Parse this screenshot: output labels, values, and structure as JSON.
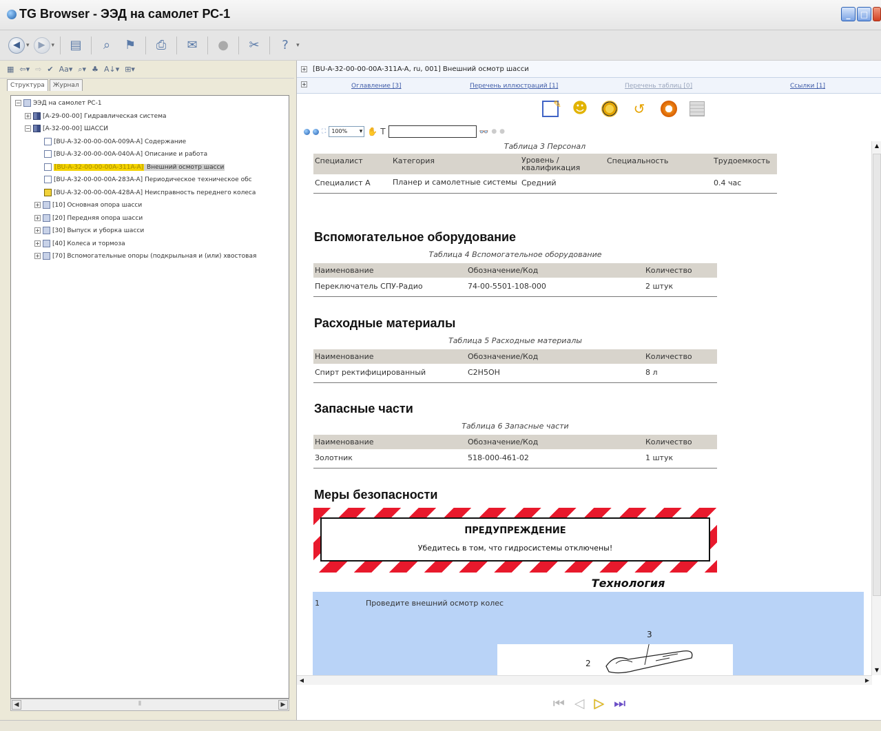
{
  "window": {
    "title": "TG Browser - ЭЭД на самолет РС-1"
  },
  "left": {
    "tabs": [
      "Структура",
      "Журнал"
    ],
    "tree": [
      {
        "indent": 0,
        "exp": "−",
        "icon": "folder",
        "label": "ЭЭД на самолет РС-1"
      },
      {
        "indent": 1,
        "exp": "+",
        "icon": "book",
        "label": "[A-29-00-00] Гидравлическая система"
      },
      {
        "indent": 1,
        "exp": "−",
        "icon": "book",
        "label": "[A-32-00-00] ШАССИ"
      },
      {
        "indent": 3,
        "exp": "",
        "icon": "doc",
        "label": "[BU-A-32-00-00-00A-009A-A] Содержание"
      },
      {
        "indent": 3,
        "exp": "",
        "icon": "doc",
        "label": "[BU-A-32-00-00-00A-040A-A] Описание и работа"
      },
      {
        "indent": 3,
        "exp": "",
        "icon": "doc",
        "label": "[BU-A-32-00-00-00A-311A-A]",
        "label2": " Внешний осмотр шасси",
        "selected": true
      },
      {
        "indent": 3,
        "exp": "",
        "icon": "doc",
        "label": "[BU-A-32-00-00-00A-283A-A] Периодическое техническое обс"
      },
      {
        "indent": 3,
        "exp": "",
        "icon": "warn",
        "label": "[BU-A-32-00-00-00A-428A-A] Неисправность переднего колеса"
      },
      {
        "indent": 2,
        "exp": "+",
        "icon": "folder",
        "label": "[10] Основная опора шасси"
      },
      {
        "indent": 2,
        "exp": "+",
        "icon": "folder",
        "label": "[20] Передняя опора шасси"
      },
      {
        "indent": 2,
        "exp": "+",
        "icon": "folder",
        "label": "[30] Выпуск и уборка шасси"
      },
      {
        "indent": 2,
        "exp": "+",
        "icon": "folder",
        "label": "[40] Колеса и тормоза"
      },
      {
        "indent": 2,
        "exp": "+",
        "icon": "folder",
        "label": "[70] Вспомогательные опоры (подкрыльная и (или) хвостовая"
      }
    ]
  },
  "doc": {
    "header": "[BU-A-32-00-00-00A-311A-A, ru, 001] Внешний осмотр шасси",
    "links": [
      {
        "label": "Оглавление [3]",
        "dim": false
      },
      {
        "label": "Перечень иллюстраций [1]",
        "dim": false
      },
      {
        "label": "Перечень таблиц [0]",
        "dim": true
      },
      {
        "label": "Ссылки [1]",
        "dim": false
      }
    ],
    "zoom": "100%",
    "search_value": "",
    "personnel": {
      "caption": "Таблица 3  Персонал",
      "headers": [
        "Специалист",
        "Категория",
        "Уровень / квалификация",
        "Специальность",
        "Трудоемкость"
      ],
      "row": [
        "Специалист А",
        "Планер и самолетные системы",
        "Средний",
        "",
        "0.4 час"
      ]
    },
    "equipment": {
      "heading": "Вспомогательное оборудование",
      "caption": "Таблица 4  Вспомогательное оборудование",
      "headers": [
        "Наименование",
        "Обозначение/Код",
        "Количество"
      ],
      "row": [
        "Переключатель СПУ-Радио",
        "74-00-5501-108-000",
        "2 штук"
      ]
    },
    "consumables": {
      "heading": "Расходные материалы",
      "caption": "Таблица 5  Расходные материалы",
      "headers": [
        "Наименование",
        "Обозначение/Код",
        "Количество"
      ],
      "row": [
        "Спирт ректифицированный",
        "C2H5OH",
        "8 л"
      ]
    },
    "spares": {
      "heading": "Запасные части",
      "caption": "Таблица 6  Запасные части",
      "headers": [
        "Наименование",
        "Обозначение/Код",
        "Количество"
      ],
      "row": [
        "Золотник",
        "518-000-461-02",
        "1 штук"
      ]
    },
    "safety": {
      "heading": "Меры безопасности",
      "warning_title": "ПРЕДУПРЕЖДЕНИЕ",
      "warning_text": "Убедитесь в том, что гидросистемы отключены!"
    },
    "technology": {
      "heading": "Технология",
      "step_num": "1",
      "step_text": "Проведите внешний осмотр колес",
      "fig_labels": [
        "2",
        "3"
      ]
    }
  }
}
